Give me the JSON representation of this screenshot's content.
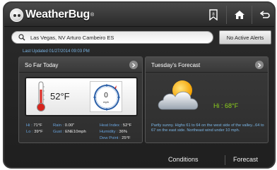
{
  "app": {
    "name": "WeatherBug",
    "trademark": "®"
  },
  "topbar": {
    "icons": [
      "save-icon",
      "home-icon",
      "back-icon"
    ]
  },
  "search": {
    "location": "Las Vegas, NV Arturo Cambeiro ES",
    "icon": "search-icon"
  },
  "alerts": {
    "label": "No Active Alerts"
  },
  "updated": "Last Updated 01/27/2014 09:03 PM",
  "today": {
    "title": "So Far Today",
    "temperature": "52°F",
    "wind_speed": "0",
    "wind_unit": "mph",
    "hi_label": "Hi :",
    "hi_value": "71°F",
    "lo_label": "Lo :",
    "lo_value": "39°F",
    "rain_label": "Rain :",
    "rain_value": "0.00\"",
    "gust_label": "Gust :",
    "gust_value": "ENE10mph",
    "heat_label": "Heat Index :",
    "heat_value": "52°F",
    "humidity_label": "Humidity :",
    "humidity_value": "36%",
    "dew_label": "Dew Point :",
    "dew_value": "25°F"
  },
  "forecast": {
    "title": "Tuesday's Forecast",
    "hi": "Hi : 68°F",
    "text": "Partly sunny. Highs 61 to 64 on the west side of the valley...64 to 67 on the east side. Northeast wind under 10 mph."
  },
  "nav": {
    "conditions": "Conditions",
    "forecast": "Forecast"
  },
  "colors": {
    "accent_blue": "#7cb8e8",
    "hi_green": "#8ed21c",
    "background": "#1f1f1f"
  }
}
